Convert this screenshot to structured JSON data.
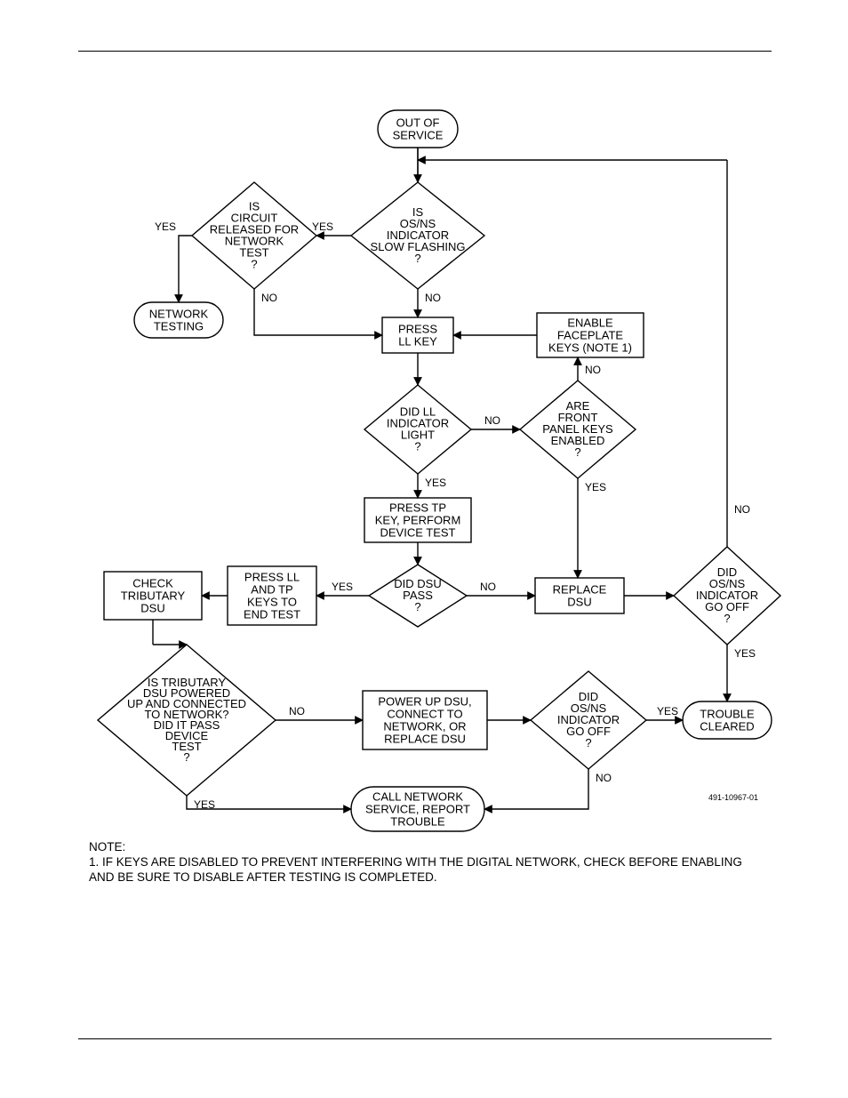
{
  "nodes": {
    "start": [
      "OUT OF",
      "SERVICE"
    ],
    "d_osns_slow": [
      "IS",
      "OS/NS",
      "INDICATOR",
      "SLOW FLASHING",
      "?"
    ],
    "d_circuit": [
      "IS",
      "CIRCUIT",
      "RELEASED FOR",
      "NETWORK",
      "TEST",
      "?"
    ],
    "t_networktesting": [
      "NETWORK",
      "TESTING"
    ],
    "p_pressll": [
      "PRESS",
      "LL KEY"
    ],
    "p_enablekeys": [
      "ENABLE",
      "FACEPLATE",
      "KEYS (NOTE 1)"
    ],
    "d_didll": [
      "DID LL",
      "INDICATOR",
      "LIGHT",
      "?"
    ],
    "d_frontpanel": [
      "ARE",
      "FRONT",
      "PANEL KEYS",
      "ENABLED",
      "?"
    ],
    "p_presstp": [
      "PRESS TP",
      "KEY, PERFORM",
      "DEVICE TEST"
    ],
    "d_dsupass": [
      "DID DSU",
      "PASS",
      "?"
    ],
    "p_endtest": [
      "PRESS LL",
      "AND TP",
      "KEYS TO",
      "END TEST"
    ],
    "p_checktrib": [
      "CHECK",
      "TRIBUTARY",
      "DSU"
    ],
    "p_replacedsu": [
      "REPLACE",
      "DSU"
    ],
    "d_osns_off1": [
      "DID",
      "OS/NS",
      "INDICATOR",
      "GO OFF",
      "?"
    ],
    "d_tribdsu": [
      "IS TRIBUTARY",
      "DSU POWERED",
      "UP AND CONNECTED",
      "TO NETWORK?",
      "DID IT PASS",
      "DEVICE",
      "TEST",
      "?"
    ],
    "p_powerup": [
      "POWER UP DSU,",
      "CONNECT TO",
      "NETWORK, OR",
      "REPLACE DSU"
    ],
    "d_osns_off2": [
      "DID",
      "OS/NS",
      "INDICATOR",
      "GO OFF",
      "?"
    ],
    "t_trouble": [
      "TROUBLE",
      "CLEARED"
    ],
    "t_callnet": [
      "CALL NETWORK",
      "SERVICE, REPORT",
      "TROUBLE"
    ]
  },
  "labels": {
    "yes": "YES",
    "no": "NO"
  },
  "figid": "491-10967-01",
  "note_title": "NOTE:",
  "note_body": "1. IF KEYS ARE DISABLED TO PREVENT INTERFERING WITH THE DIGITAL NETWORK, CHECK BEFORE ENABLING AND BE SURE TO DISABLE AFTER TESTING IS COMPLETED."
}
